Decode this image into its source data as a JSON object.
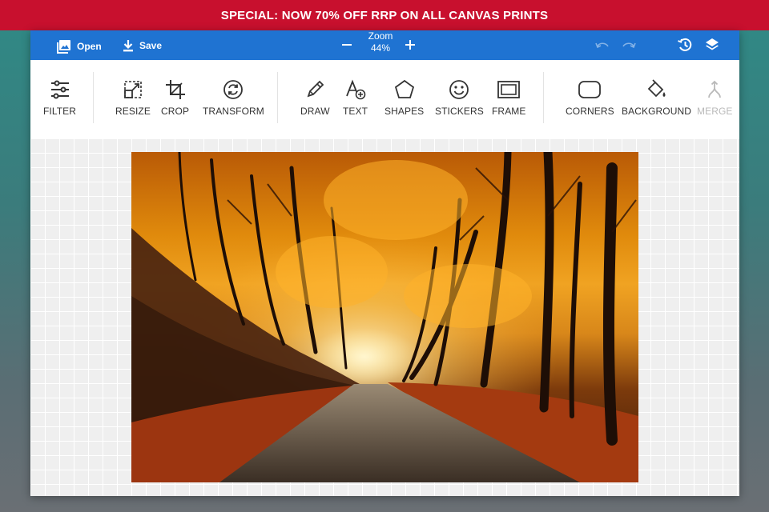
{
  "promo": {
    "text": "SPECIAL: NOW 70% OFF RRP ON ALL CANVAS PRINTS"
  },
  "topbar": {
    "open_label": "Open",
    "save_label": "Save",
    "zoom_label": "Zoom",
    "zoom_value": "44%"
  },
  "tools": {
    "filter": "FILTER",
    "resize": "RESIZE",
    "crop": "CROP",
    "transform": "TRANSFORM",
    "draw": "DRAW",
    "text": "TEXT",
    "shapes": "SHAPES",
    "stickers": "STICKERS",
    "frame": "FRAME",
    "corners": "CORNERS",
    "background": "BACKGROUND",
    "merge": "MERGE"
  },
  "colors": {
    "promo_bg": "#c8102e",
    "topbar_bg": "#1f73d2"
  },
  "icons": {
    "open": "image-icon",
    "save": "download-icon",
    "undo": "undo-icon",
    "redo": "redo-icon",
    "history": "history-icon",
    "layers": "layers-icon"
  }
}
